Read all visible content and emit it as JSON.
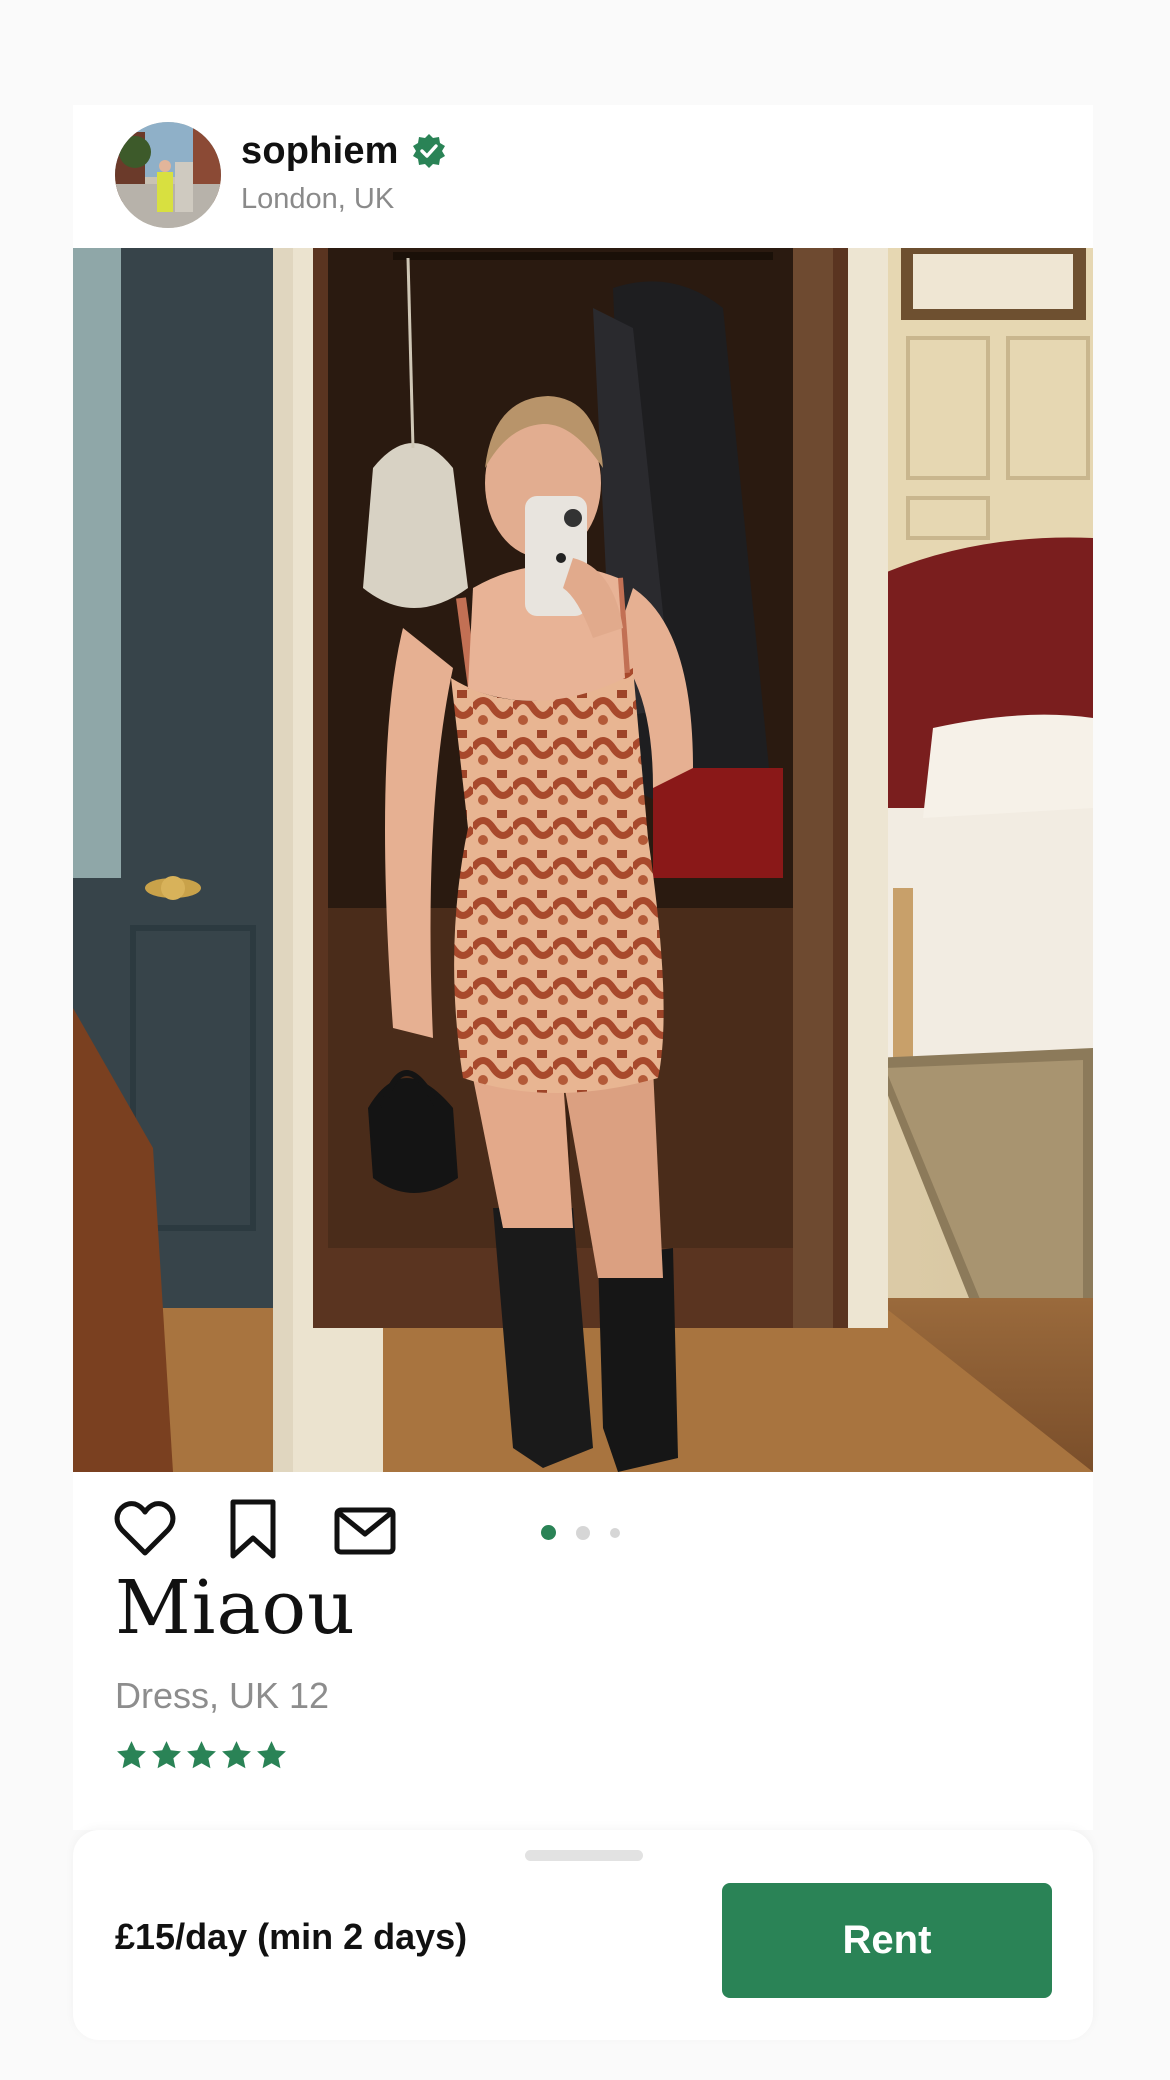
{
  "post": {
    "username": "sophiem",
    "location": "London, UK",
    "verified": true
  },
  "carousel": {
    "total_images": 3,
    "active_index": 1
  },
  "item": {
    "title": "Miaou",
    "subtitle": "Dress, UK 12",
    "rating_stars": 5
  },
  "rental": {
    "price_text": "£15/day (min 2 days)",
    "rent_label": "Rent"
  },
  "icons": {
    "like": "heart-icon",
    "save": "bookmark-icon",
    "message": "mail-icon",
    "verified": "verified-badge-icon",
    "rating": "star-icon"
  },
  "colors": {
    "accent": "#2a8356",
    "inactive_dot": "#d6d6d6",
    "muted_text": "#8a8a8a"
  }
}
